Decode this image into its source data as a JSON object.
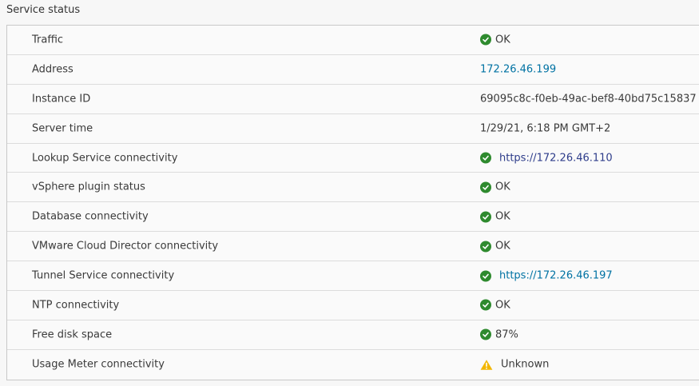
{
  "section_title": "Service status",
  "rows": [
    {
      "label": "Traffic",
      "value": "OK",
      "status": "ok",
      "kind": "text"
    },
    {
      "label": "Address",
      "value": "172.26.46.199",
      "status": "none",
      "kind": "link"
    },
    {
      "label": "Instance ID",
      "value": "69095c8c-f0eb-49ac-bef8-40bd75c15837",
      "status": "none",
      "kind": "text"
    },
    {
      "label": "Server time",
      "value": "1/29/21, 6:18 PM GMT+2",
      "status": "none",
      "kind": "text"
    },
    {
      "label": "Lookup Service connectivity",
      "value": "https://172.26.46.110",
      "status": "ok",
      "kind": "link"
    },
    {
      "label": "vSphere plugin status",
      "value": "OK",
      "status": "ok",
      "kind": "text"
    },
    {
      "label": "Database connectivity",
      "value": "OK",
      "status": "ok",
      "kind": "text"
    },
    {
      "label": "VMware Cloud Director connectivity",
      "value": "OK",
      "status": "ok",
      "kind": "text"
    },
    {
      "label": "Tunnel Service connectivity",
      "value": "https://172.26.46.197",
      "status": "ok",
      "kind": "link"
    },
    {
      "label": "NTP connectivity",
      "value": "OK",
      "status": "ok",
      "kind": "text"
    },
    {
      "label": "Free disk space",
      "value": "87%",
      "status": "ok",
      "kind": "text"
    },
    {
      "label": "Usage Meter connectivity",
      "value": "Unknown",
      "status": "warning",
      "kind": "text"
    }
  ],
  "colors": {
    "ok": "#2e8a2e",
    "warning": "#f2b600",
    "link": "#0072a3"
  },
  "icons": {
    "ok": "check-circle-icon",
    "warning": "warning-triangle-icon"
  }
}
